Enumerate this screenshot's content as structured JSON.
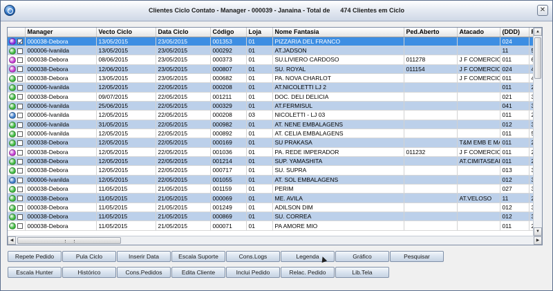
{
  "window": {
    "title": "Clientes Ciclo Contato - Manager - 000039 - Janaina - Total de      474 Clientes em Ciclo"
  },
  "grid": {
    "columns": [
      "",
      "Manager",
      "Vecto Ciclo",
      "Data Ciclo",
      "Código",
      "Loja",
      "Nome Fantasia",
      "Ped.Aberto",
      "Atacado",
      "(DDD)",
      "F"
    ],
    "rows": [
      {
        "status": "#8a2be2",
        "checked": true,
        "manager": "000038-Debora",
        "vecto": "13/05/2015",
        "data": "23/05/2015",
        "codigo": "001353",
        "loja": "01",
        "nome": "PIZZARIA DEL FRANCO",
        "ped": "",
        "atacado": "",
        "ddd": "024",
        "f": ""
      },
      {
        "status": "#3cb83c",
        "checked": false,
        "manager": "000006-Ivanilda",
        "vecto": "13/05/2015",
        "data": "23/05/2015",
        "codigo": "000292",
        "loja": "01",
        "nome": "AT.JADSON",
        "ped": "",
        "atacado": "",
        "ddd": "11",
        "f": "5"
      },
      {
        "status": "#c238d0",
        "checked": false,
        "manager": "000038-Debora",
        "vecto": "08/06/2015",
        "data": "23/05/2015",
        "codigo": "000373",
        "loja": "01",
        "nome": "SU.LIVIERO CARDOSO",
        "ped": "011278",
        "atacado": "J F COMERCIO",
        "ddd": "011",
        "f": "6"
      },
      {
        "status": "#c238d0",
        "checked": false,
        "manager": "000038-Debora",
        "vecto": "12/06/2015",
        "data": "23/05/2015",
        "codigo": "000807",
        "loja": "01",
        "nome": "SU. ROYAL",
        "ped": "011154",
        "atacado": "J F COMERCIO",
        "ddd": "024",
        "f": "4"
      },
      {
        "status": "#3cb83c",
        "checked": false,
        "manager": "000038-Debora",
        "vecto": "13/05/2015",
        "data": "23/05/2015",
        "codigo": "000682",
        "loja": "01",
        "nome": "PA. NOVA CHARLOT",
        "ped": "",
        "atacado": "J F COMERCIO",
        "ddd": "011",
        "f": "4"
      },
      {
        "status": "#3cb83c",
        "checked": false,
        "manager": "000006-Ivanilda",
        "vecto": "12/05/2015",
        "data": "22/05/2015",
        "codigo": "000208",
        "loja": "01",
        "nome": "AT.NICOLETTI LJ 2",
        "ped": "",
        "atacado": "",
        "ddd": "011",
        "f": "2"
      },
      {
        "status": "#3cb83c",
        "checked": false,
        "manager": "000038-Debora",
        "vecto": "09/07/2015",
        "data": "22/05/2015",
        "codigo": "001211",
        "loja": "01",
        "nome": "DOC. DELI DELICIA",
        "ped": "",
        "atacado": "",
        "ddd": "021",
        "f": "3"
      },
      {
        "status": "#3cb83c",
        "checked": false,
        "manager": "000006-Ivanilda",
        "vecto": "25/06/2015",
        "data": "22/05/2015",
        "codigo": "000329",
        "loja": "01",
        "nome": "AT.FERMISUL",
        "ped": "",
        "atacado": "",
        "ddd": "041",
        "f": "3"
      },
      {
        "status": "#3a7ac8",
        "checked": false,
        "manager": "000006-Ivanilda",
        "vecto": "12/05/2015",
        "data": "22/05/2015",
        "codigo": "000208",
        "loja": "03",
        "nome": " NICOLETTI - LJ 03",
        "ped": "",
        "atacado": "",
        "ddd": "011",
        "f": "2"
      },
      {
        "status": "#3cb83c",
        "checked": false,
        "manager": "000006-Ivanilda",
        "vecto": "31/05/2015",
        "data": "22/05/2015",
        "codigo": "000982",
        "loja": "01",
        "nome": "AT. NENE EMBALAGENS",
        "ped": "",
        "atacado": "",
        "ddd": "012",
        "f": "3"
      },
      {
        "status": "#3cb83c",
        "checked": false,
        "manager": "000006-Ivanilda",
        "vecto": "12/05/2015",
        "data": "22/05/2015",
        "codigo": "000892",
        "loja": "01",
        "nome": "AT. CELIA EMBALAGENS",
        "ped": "",
        "atacado": "",
        "ddd": "011",
        "f": "5"
      },
      {
        "status": "#3cb83c",
        "checked": false,
        "manager": "000038-Debora",
        "vecto": "12/05/2015",
        "data": "22/05/2015",
        "codigo": "000169",
        "loja": "01",
        "nome": "SU PRAKASA",
        "ped": "",
        "atacado": "T&M EMB E MA",
        "ddd": "011",
        "f": "2"
      },
      {
        "status": "#c238d0",
        "checked": false,
        "manager": "000038-Debora",
        "vecto": "12/05/2015",
        "data": "22/05/2015",
        "codigo": "001036",
        "loja": "01",
        "nome": "PA. REDE IMPERADOR",
        "ped": "011232",
        "atacado": "J F COMERCIO",
        "ddd": "011",
        "f": "2"
      },
      {
        "status": "#3cb83c",
        "checked": false,
        "manager": "000038-Debora",
        "vecto": "12/05/2015",
        "data": "22/05/2015",
        "codigo": "001214",
        "loja": "01",
        "nome": "SUP. YAMASHITA",
        "ped": "",
        "atacado": "AT.CIMITASEAI",
        "ddd": "011",
        "f": "2"
      },
      {
        "status": "#3cb83c",
        "checked": false,
        "manager": "000038-Debora",
        "vecto": "12/05/2015",
        "data": "22/05/2015",
        "codigo": "000717",
        "loja": "01",
        "nome": "SU. SUPRA",
        "ped": "",
        "atacado": "",
        "ddd": "013",
        "f": "3"
      },
      {
        "status": "#3a7ac8",
        "checked": false,
        "manager": "000006-Ivanilda",
        "vecto": "12/05/2015",
        "data": "22/05/2015",
        "codigo": "001055",
        "loja": "01",
        "nome": "AT. SOL EMBALAGENS",
        "ped": "",
        "atacado": "",
        "ddd": "012",
        "f": "3"
      },
      {
        "status": "#3cb83c",
        "checked": false,
        "manager": "000038-Debora",
        "vecto": "11/05/2015",
        "data": "21/05/2015",
        "codigo": "001159",
        "loja": "01",
        "nome": "PERIM",
        "ped": "",
        "atacado": "",
        "ddd": "027",
        "f": "3"
      },
      {
        "status": "#3cb83c",
        "checked": false,
        "manager": "000038-Debora",
        "vecto": "11/05/2015",
        "data": "21/05/2015",
        "codigo": "000069",
        "loja": "01",
        "nome": "ME. AVILA",
        "ped": "",
        "atacado": "AT.VELOSO",
        "ddd": "11",
        "f": "2"
      },
      {
        "status": "#3cb83c",
        "checked": false,
        "manager": "000038-Debora",
        "vecto": "11/05/2015",
        "data": "21/05/2015",
        "codigo": "001249",
        "loja": "01",
        "nome": "ADILSON DIM",
        "ped": "",
        "atacado": "",
        "ddd": "012",
        "f": "3"
      },
      {
        "status": "#3cb83c",
        "checked": false,
        "manager": "000038-Debora",
        "vecto": "11/05/2015",
        "data": "21/05/2015",
        "codigo": "000869",
        "loja": "01",
        "nome": "SU. CORREA",
        "ped": "",
        "atacado": "",
        "ddd": "012",
        "f": "3"
      },
      {
        "status": "#3cb83c",
        "checked": false,
        "manager": "000038-Debora",
        "vecto": "11/05/2015",
        "data": "21/05/2015",
        "codigo": "000071",
        "loja": "01",
        "nome": "PA AMORE MIO",
        "ped": "",
        "atacado": "",
        "ddd": "011",
        "f": "2"
      }
    ]
  },
  "buttons_row1": [
    "Repete Pedido",
    "Pula Ciclo",
    "Inserir Data",
    "Escala Suporte",
    "Cons.Logs",
    "Legenda",
    "Gráfico",
    "Pesquisar"
  ],
  "buttons_row2": [
    "Escala Hunter",
    "Histórico",
    "Cons.Pedidos",
    "Edita Cliente",
    "Inclui Pedido",
    "Relac. Pedido",
    "Lib.Tela"
  ]
}
